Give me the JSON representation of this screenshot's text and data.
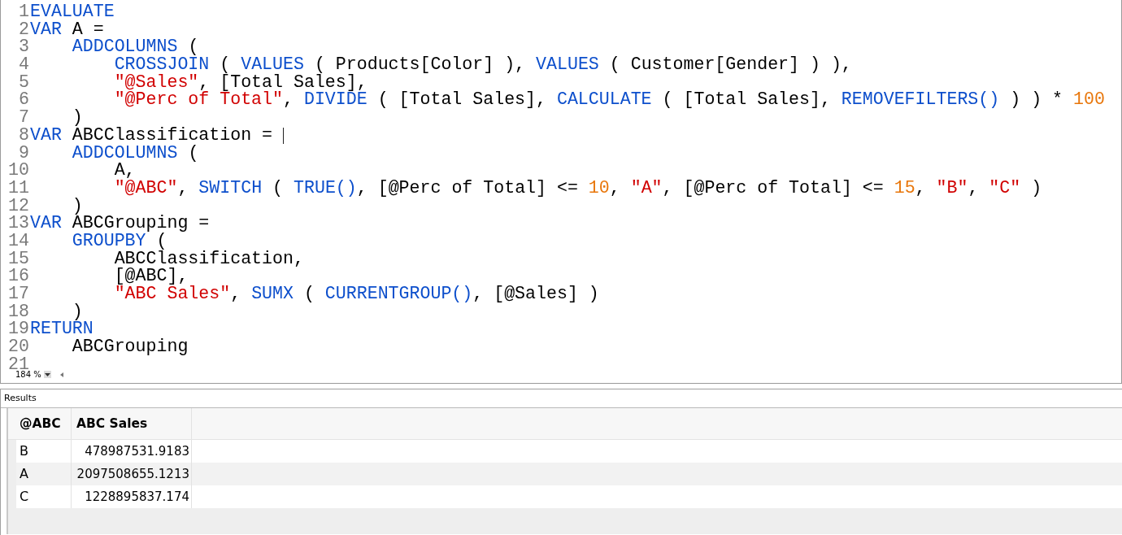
{
  "editor": {
    "lines": [
      {
        "number": "1",
        "caret": false,
        "tokens": [
          {
            "kind": "keyword",
            "text": "EVALUATE"
          }
        ]
      },
      {
        "number": "2",
        "caret": false,
        "tokens": [
          {
            "kind": "keyword",
            "text": "VAR"
          },
          {
            "kind": "plain",
            "text": " A ="
          }
        ],
        "children": [
          {
            "number": "3",
            "caret": false,
            "tokens": [
              {
                "kind": "keyword",
                "text": "ADDCOLUMNS"
              },
              {
                "kind": "plain",
                "text": " ("
              }
            ],
            "children": [
              {
                "number": "4",
                "caret": false,
                "tokens": [
                  {
                    "kind": "keyword",
                    "text": "CROSSJOIN"
                  },
                  {
                    "kind": "plain",
                    "text": " ( "
                  },
                  {
                    "kind": "keyword",
                    "text": "VALUES"
                  },
                  {
                    "kind": "plain",
                    "text": " ( Products[Color] ), "
                  },
                  {
                    "kind": "keyword",
                    "text": "VALUES"
                  },
                  {
                    "kind": "plain",
                    "text": " ( Customer[Gender] ) ),"
                  }
                ]
              },
              {
                "number": "5",
                "caret": false,
                "tokens": [
                  {
                    "kind": "string",
                    "text": "\"@Sales\""
                  },
                  {
                    "kind": "plain",
                    "text": ", [Total Sales],"
                  }
                ]
              },
              {
                "number": "6",
                "caret": false,
                "tokens": [
                  {
                    "kind": "string",
                    "text": "\"@Perc of Total\""
                  },
                  {
                    "kind": "plain",
                    "text": ", "
                  },
                  {
                    "kind": "keyword",
                    "text": "DIVIDE"
                  },
                  {
                    "kind": "plain",
                    "text": " ( [Total Sales], "
                  },
                  {
                    "kind": "keyword",
                    "text": "CALCULATE"
                  },
                  {
                    "kind": "plain",
                    "text": " ( [Total Sales], "
                  },
                  {
                    "kind": "keyword",
                    "text": "REMOVEFILTERS()"
                  },
                  {
                    "kind": "plain",
                    "text": " ) ) * "
                  },
                  {
                    "kind": "number",
                    "text": "100"
                  }
                ]
              }
            ]
          },
          {
            "number": "7",
            "caret": false,
            "tokens": [
              {
                "kind": "plain",
                "text": ")"
              }
            ]
          }
        ]
      },
      {
        "number": "8",
        "caret": true,
        "tokens": [
          {
            "kind": "keyword",
            "text": "VAR"
          },
          {
            "kind": "plain",
            "text": " ABCClassification = "
          }
        ],
        "children": [
          {
            "number": "9",
            "caret": false,
            "tokens": [
              {
                "kind": "keyword",
                "text": "ADDCOLUMNS"
              },
              {
                "kind": "plain",
                "text": " ("
              }
            ],
            "children": [
              {
                "number": "10",
                "caret": false,
                "tokens": [
                  {
                    "kind": "plain",
                    "text": "A,"
                  }
                ]
              },
              {
                "number": "11",
                "caret": false,
                "tokens": [
                  {
                    "kind": "string",
                    "text": "\"@ABC\""
                  },
                  {
                    "kind": "plain",
                    "text": ", "
                  },
                  {
                    "kind": "keyword",
                    "text": "SWITCH"
                  },
                  {
                    "kind": "plain",
                    "text": " ( "
                  },
                  {
                    "kind": "keyword",
                    "text": "TRUE()"
                  },
                  {
                    "kind": "plain",
                    "text": ", [@Perc of Total] <= "
                  },
                  {
                    "kind": "number",
                    "text": "10"
                  },
                  {
                    "kind": "plain",
                    "text": ", "
                  },
                  {
                    "kind": "string",
                    "text": "\"A\""
                  },
                  {
                    "kind": "plain",
                    "text": ", [@Perc of Total] <= "
                  },
                  {
                    "kind": "number",
                    "text": "15"
                  },
                  {
                    "kind": "plain",
                    "text": ", "
                  },
                  {
                    "kind": "string",
                    "text": "\"B\""
                  },
                  {
                    "kind": "plain",
                    "text": ", "
                  },
                  {
                    "kind": "string",
                    "text": "\"C\""
                  },
                  {
                    "kind": "plain",
                    "text": " )"
                  }
                ]
              }
            ]
          },
          {
            "number": "12",
            "caret": false,
            "tokens": [
              {
                "kind": "plain",
                "text": ")"
              }
            ]
          }
        ]
      },
      {
        "number": "13",
        "caret": false,
        "tokens": [
          {
            "kind": "keyword",
            "text": "VAR"
          },
          {
            "kind": "plain",
            "text": " ABCGrouping ="
          }
        ],
        "children": [
          {
            "number": "14",
            "caret": false,
            "tokens": [
              {
                "kind": "keyword",
                "text": "GROUPBY"
              },
              {
                "kind": "plain",
                "text": " ("
              }
            ],
            "children": [
              {
                "number": "15",
                "caret": false,
                "tokens": [
                  {
                    "kind": "plain",
                    "text": "ABCClassification,"
                  }
                ]
              },
              {
                "number": "16",
                "caret": false,
                "tokens": [
                  {
                    "kind": "plain",
                    "text": "[@ABC],"
                  }
                ]
              },
              {
                "number": "17",
                "caret": false,
                "tokens": [
                  {
                    "kind": "string",
                    "text": "\"ABC Sales\""
                  },
                  {
                    "kind": "plain",
                    "text": ", "
                  },
                  {
                    "kind": "keyword",
                    "text": "SUMX"
                  },
                  {
                    "kind": "plain",
                    "text": " ( "
                  },
                  {
                    "kind": "keyword",
                    "text": "CURRENTGROUP()"
                  },
                  {
                    "kind": "plain",
                    "text": ", [@Sales] )"
                  }
                ]
              }
            ]
          },
          {
            "number": "18",
            "caret": false,
            "tokens": [
              {
                "kind": "plain",
                "text": ")"
              }
            ]
          }
        ]
      },
      {
        "number": "19",
        "caret": false,
        "tokens": [
          {
            "kind": "keyword",
            "text": "RETURN"
          }
        ],
        "children": [
          {
            "number": "20",
            "caret": false,
            "tokens": [
              {
                "kind": "plain",
                "text": "ABCGrouping"
              }
            ]
          }
        ]
      },
      {
        "number": "21",
        "caret": false
      }
    ],
    "zoom": "184 %"
  },
  "results": {
    "title": "Results",
    "columns": [
      "@ABC",
      "ABC Sales"
    ],
    "rows": [
      {
        "cells": [
          "B",
          "478987531.9183"
        ]
      },
      {
        "cells": [
          "A",
          "2097508655.1213"
        ]
      },
      {
        "cells": [
          "C",
          "1228895837.174"
        ]
      }
    ]
  }
}
